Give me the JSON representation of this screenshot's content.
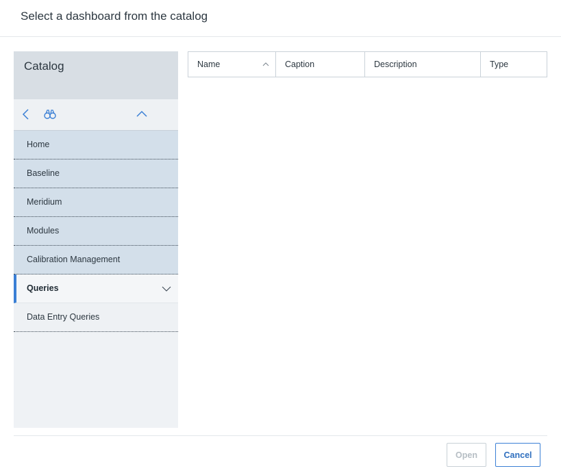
{
  "dialog": {
    "title": "Select a dashboard from the catalog"
  },
  "catalog": {
    "title": "Catalog",
    "toolbar": {
      "back_icon": "chevron-left-icon",
      "find_icon": "binoculars-icon",
      "collapse_icon": "chevron-up-icon"
    },
    "items": [
      {
        "label": "Home"
      },
      {
        "label": "Baseline"
      },
      {
        "label": "Meridium"
      },
      {
        "label": "Modules"
      },
      {
        "label": "Calibration Management"
      },
      {
        "label": "Queries"
      },
      {
        "label": "Data Entry Queries"
      }
    ],
    "selected_index": 5
  },
  "table": {
    "columns": [
      {
        "label": "Name",
        "sorted": "ascending"
      },
      {
        "label": "Caption"
      },
      {
        "label": "Description"
      },
      {
        "label": "Type"
      }
    ],
    "rows": []
  },
  "footer": {
    "open_label": "Open",
    "cancel_label": "Cancel"
  },
  "colors": {
    "accent": "#3a7fd5",
    "catalog_item_bg": "#d3dfea",
    "catalog_header_bg": "#d8dee4"
  }
}
